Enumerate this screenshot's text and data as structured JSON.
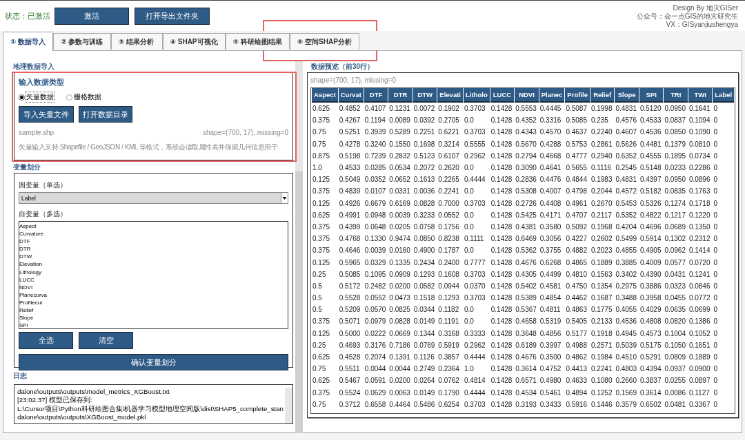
{
  "status": "状态：已激活",
  "header_buttons": [
    "激活",
    "打开导出文件夹"
  ],
  "credits": [
    "Design By 地灾GISer",
    "公众号：会一点GIS的地灾研究生",
    "VX：GISyanjiushengya"
  ],
  "tabs": [
    {
      "label": "① 数据导入",
      "selected": true
    },
    {
      "label": "② 参数与训练",
      "selected": false
    },
    {
      "label": "③ 结果分析",
      "selected": false
    },
    {
      "label": "④ SHAP可视化",
      "selected": false
    },
    {
      "label": "⑤ 科研绘图结果",
      "selected": false
    },
    {
      "label": "⑥ 空间SHAP分析",
      "selected": false
    }
  ],
  "import_section": {
    "title": "地理数据导入",
    "group_title": "输入数据类型",
    "data_types": [
      {
        "label": "矢量数据",
        "selected": true
      },
      {
        "label": "栅格数据",
        "selected": false
      }
    ],
    "buttons": [
      "导入矢量文件",
      "打开数据目录"
    ],
    "file_name": "sample.shp",
    "shape_info": "shape=(700, 17), missing=0",
    "description": "矢量输入支持 Shapefile / GeoJSON / KML 等格式，系统会读取属性表并保留几何信息用于"
  },
  "variables_section": {
    "title": "变量划分",
    "dependent_label": "因变量（单选）",
    "dependent_value": "Label",
    "independent_label": "自变量（多选）",
    "independent_items": [
      "Aspect",
      "Curvature",
      "DTF",
      "DTR",
      "DTW",
      "Elevation",
      "Lithology",
      "LUCC",
      "NDVI",
      "Planecurva",
      "Profilecur",
      "Relief",
      "Slope",
      "SPI"
    ],
    "buttons": [
      "全选",
      "清空"
    ],
    "confirm_button": "确认变量划分"
  },
  "log": {
    "title": "日志",
    "lines": [
      "dalone\\outputs\\outputs\\model_metrics_XGBoost.txt",
      "[23:02:37] 模型已保存到:",
      "L:\\Cursor项目\\Python科研绘图合集\\机器学习模型地理空间版\\dist\\SHAP5_complete_stan",
      "dalone\\outputs\\outputs\\XGBoost_model.pkl"
    ]
  },
  "preview": {
    "title": "数据预览（前30行）",
    "shape_info": "shape=(700, 17), missing=0",
    "table": {
      "columns": [
        "Aspect",
        "Curvat",
        "DTF",
        "DTR",
        "DTW",
        "Elevati",
        "Litholo",
        "LUCC",
        "NDVI",
        "Planec",
        "Profile",
        "Relief",
        "Slope",
        "SPI",
        "TRI",
        "TWI",
        "Label"
      ],
      "rows": [
        [
          "0.625",
          "0.4852",
          "0.4107",
          "0.1231",
          "0.0072",
          "0.1902",
          "0.3703",
          "0.1428",
          "0.5553",
          "0.4445",
          "0.5087",
          "0.1998",
          "0.4831",
          "0.5120",
          "0.0950",
          "0.1641",
          "0"
        ],
        [
          "0.375",
          "0.4267",
          "0.1194",
          "0.0089",
          "0.0392",
          "0.2705",
          "0.0",
          "0.1428",
          "0.4352",
          "0.3316",
          "0.5085",
          "0.235",
          "0.4576",
          "0.4533",
          "0.0837",
          "0.1094",
          "0"
        ],
        [
          "0.75",
          "0.5251",
          "0.3939",
          "0.5289",
          "0.2251",
          "0.6221",
          "0.3703",
          "0.1428",
          "0.4343",
          "0.4570",
          "0.4637",
          "0.2240",
          "0.4607",
          "0.4536",
          "0.0850",
          "0.1090",
          "0"
        ],
        [
          "0.75",
          "0.4278",
          "0.3240",
          "0.1550",
          "0.1698",
          "0.3214",
          "0.5555",
          "0.1428",
          "0.5670",
          "0.4288",
          "0.5753",
          "0.2861",
          "0.5626",
          "0.4481",
          "0.1379",
          "0.0810",
          "0"
        ],
        [
          "0.875",
          "0.5198",
          "0.7239",
          "0.2832",
          "0.5123",
          "0.6107",
          "0.2962",
          "0.1428",
          "0.2794",
          "0.4668",
          "0.4777",
          "0.2940",
          "0.6352",
          "0.4555",
          "0.1895",
          "0.0734",
          "0"
        ],
        [
          "1.0",
          "0.4533",
          "0.0285",
          "0.0534",
          "0.2072",
          "0.2620",
          "0.0",
          "0.1428",
          "0.3090",
          "0.4641",
          "0.5655",
          "0.1116",
          "0.2545",
          "0.5148",
          "0.0233",
          "0.2286",
          "0"
        ],
        [
          "0.125",
          "0.5049",
          "0.0352",
          "0.0652",
          "0.1613",
          "0.2265",
          "0.4444",
          "0.1428",
          "0.2836",
          "0.4476",
          "0.4844",
          "0.1983",
          "0.4831",
          "0.4397",
          "0.0950",
          "0.0896",
          "0"
        ],
        [
          "0.375",
          "0.4839",
          "0.0107",
          "0.0331",
          "0.0036",
          "0.2241",
          "0.0",
          "0.1428",
          "0.5308",
          "0.4007",
          "0.4798",
          "0.2044",
          "0.4572",
          "0.5182",
          "0.0835",
          "0.1763",
          "0"
        ],
        [
          "0.125",
          "0.4926",
          "0.6679",
          "0.6169",
          "0.0828",
          "0.7000",
          "0.3703",
          "0.1428",
          "0.2726",
          "0.4408",
          "0.4961",
          "0.2670",
          "0.5453",
          "0.5326",
          "0.1274",
          "0.1718",
          "0"
        ],
        [
          "0.625",
          "0.4991",
          "0.0948",
          "0.0039",
          "0.3233",
          "0.0552",
          "0.0",
          "0.1428",
          "0.5425",
          "0.4171",
          "0.4707",
          "0.2117",
          "0.5352",
          "0.4822",
          "0.1217",
          "0.1220",
          "0"
        ],
        [
          "0.375",
          "0.4399",
          "0.0648",
          "0.0205",
          "0.0758",
          "0.1756",
          "0.0",
          "0.1428",
          "0.4381",
          "0.3580",
          "0.5092",
          "0.1968",
          "0.4204",
          "0.4696",
          "0.0689",
          "0.1350",
          "0"
        ],
        [
          "0.375",
          "0.4768",
          "0.1330",
          "0.9474",
          "0.0850",
          "0.8238",
          "0.1111",
          "0.1428",
          "0.6469",
          "0.3056",
          "0.4227",
          "0.2602",
          "0.5499",
          "0.5914",
          "0.1302",
          "0.2312",
          "0"
        ],
        [
          "0.375",
          "0.4646",
          "0.0039",
          "0.0160",
          "0.4900",
          "0.1787",
          "0.0",
          "0.1428",
          "0.5362",
          "0.3755",
          "0.4882",
          "0.2023",
          "0.4855",
          "0.4905",
          "0.0962",
          "0.1414",
          "0"
        ],
        [
          "0.125",
          "0.5965",
          "0.0329",
          "0.1335",
          "0.2434",
          "0.2400",
          "0.7777",
          "0.1428",
          "0.4676",
          "0.6268",
          "0.4865",
          "0.1889",
          "0.3885",
          "0.4009",
          "0.0577",
          "0.0720",
          "0"
        ],
        [
          "0.25",
          "0.5085",
          "0.1095",
          "0.0909",
          "0.1293",
          "0.1608",
          "0.3703",
          "0.1428",
          "0.4305",
          "0.4499",
          "0.4810",
          "0.1563",
          "0.3402",
          "0.4390",
          "0.0431",
          "0.1241",
          "0"
        ],
        [
          "0.5",
          "0.5172",
          "0.2482",
          "0.0200",
          "0.0582",
          "0.0944",
          "0.0370",
          "0.1428",
          "0.5402",
          "0.4581",
          "0.4750",
          "0.1354",
          "0.2975",
          "0.3886",
          "0.0323",
          "0.0846",
          "0"
        ],
        [
          "0.5",
          "0.5528",
          "0.0552",
          "0.0473",
          "0.1518",
          "0.1293",
          "0.3703",
          "0.1428",
          "0.5389",
          "0.4854",
          "0.4462",
          "0.1687",
          "0.3488",
          "0.3958",
          "0.0455",
          "0.0772",
          "0"
        ],
        [
          "0.5",
          "0.5209",
          "0.0570",
          "0.0825",
          "0.0344",
          "0.1182",
          "0.0",
          "0.1428",
          "0.5367",
          "0.4811",
          "0.4863",
          "0.1775",
          "0.4055",
          "0.4029",
          "0.0635",
          "0.0699",
          "0"
        ],
        [
          "0.375",
          "0.5071",
          "0.0979",
          "0.0828",
          "0.0149",
          "0.1191",
          "0.0",
          "0.1428",
          "0.4658",
          "0.5319",
          "0.5405",
          "0.2133",
          "0.4536",
          "0.4808",
          "0.0820",
          "0.1386",
          "0"
        ],
        [
          "0.125",
          "0.5000",
          "0.0222",
          "0.0669",
          "0.1344",
          "0.3168",
          "0.3333",
          "0.1428",
          "0.3648",
          "0.4856",
          "0.5177",
          "0.1918",
          "0.4945",
          "0.4573",
          "0.1004",
          "0.1052",
          "0"
        ],
        [
          "0.25",
          "0.4693",
          "0.3176",
          "0.7186",
          "0.0769",
          "0.5919",
          "0.2962",
          "0.1428",
          "0.6189",
          "0.3997",
          "0.4988",
          "0.2571",
          "0.5039",
          "0.5175",
          "0.1050",
          "0.1651",
          "0"
        ],
        [
          "0.625",
          "0.4528",
          "0.2074",
          "0.1391",
          "0.1126",
          "0.3857",
          "0.4444",
          "0.1428",
          "0.4676",
          "0.3500",
          "0.4862",
          "0.1984",
          "0.4510",
          "0.5291",
          "0.0809",
          "0.1889",
          "0"
        ],
        [
          "0.75",
          "0.5511",
          "0.0044",
          "0.0044",
          "0.2749",
          "0.2364",
          "1.0",
          "0.1428",
          "0.3614",
          "0.4752",
          "0.4413",
          "0.2241",
          "0.4803",
          "0.4394",
          "0.0937",
          "0.0900",
          "0"
        ],
        [
          "0.625",
          "0.5467",
          "0.0591",
          "0.0200",
          "0.0264",
          "0.0762",
          "0.4814",
          "0.1428",
          "0.6571",
          "0.4980",
          "0.4633",
          "0.1080",
          "0.2660",
          "0.3837",
          "0.0255",
          "0.0897",
          "0"
        ],
        [
          "0.375",
          "0.5524",
          "0.0629",
          "0.0063",
          "0.0149",
          "0.1790",
          "0.4444",
          "0.1428",
          "0.4534",
          "0.5461",
          "0.4894",
          "0.1252",
          "0.1569",
          "0.3614",
          "0.0086",
          "0.1127",
          "0"
        ],
        [
          "0.75",
          "0.3712",
          "0.6558",
          "0.4464",
          "0.5486",
          "0.6254",
          "0.3703",
          "0.1428",
          "0.3193",
          "0.3433",
          "0.5916",
          "0.1446",
          "0.3579",
          "0.6502",
          "0.0481",
          "0.3367",
          "0"
        ]
      ]
    }
  }
}
